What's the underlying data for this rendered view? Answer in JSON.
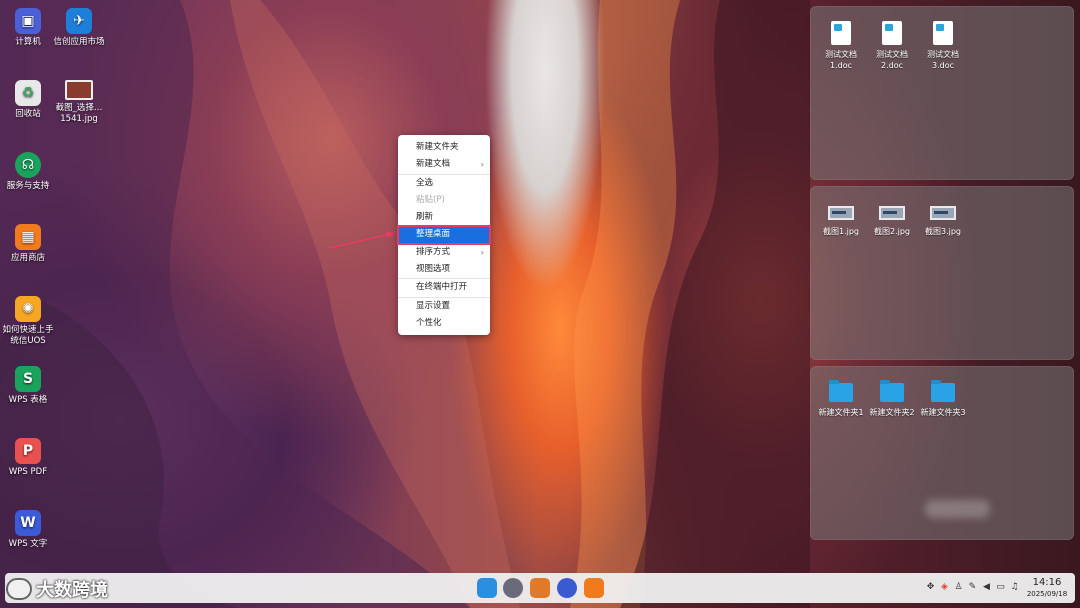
{
  "desktop": {
    "icons": [
      {
        "label": "计算机",
        "icon": "computer-icon",
        "color": "#4b5fd6"
      },
      {
        "label": "信创应用市场",
        "icon": "app-market-icon",
        "color": "#1e7fd8"
      },
      {
        "label": "回收站",
        "icon": "trash-icon",
        "color": "#e8e8e8"
      },
      {
        "label": "截图_选择…1541.jpg",
        "icon": "image-file-icon",
        "color": "#8a3b2f"
      },
      {
        "label": "服务与支持",
        "icon": "support-icon",
        "color": "#1aa35c"
      },
      {
        "label": "应用商店",
        "icon": "store-icon",
        "color": "#f07a1c"
      },
      {
        "label": "如何快速上手统信UOS",
        "icon": "bulb-icon",
        "color": "#f5a623"
      },
      {
        "label": "WPS 表格",
        "icon": "wps-sheet-icon",
        "color": "#1aa35c",
        "glyph": "S"
      },
      {
        "label": "WPS PDF",
        "icon": "wps-pdf-icon",
        "color": "#e8514f",
        "glyph": "P"
      },
      {
        "label": "WPS 文字",
        "icon": "wps-writer-icon",
        "color": "#3b5bd9",
        "glyph": "W"
      }
    ]
  },
  "panels": {
    "documents": [
      {
        "label": "测试文档1.doc"
      },
      {
        "label": "测试文档2.doc"
      },
      {
        "label": "测试文档3.doc"
      }
    ],
    "images": [
      {
        "label": "截图1.jpg"
      },
      {
        "label": "截图2.jpg"
      },
      {
        "label": "截图3.jpg"
      }
    ],
    "folders": [
      {
        "label": "新建文件夹1"
      },
      {
        "label": "新建文件夹2"
      },
      {
        "label": "新建文件夹3"
      }
    ]
  },
  "context_menu": {
    "items": [
      {
        "label": "新建文件夹",
        "submenu": false,
        "disabled": false
      },
      {
        "label": "新建文档",
        "submenu": true,
        "disabled": false
      },
      {
        "label": "全选",
        "submenu": false,
        "disabled": false
      },
      {
        "label": "粘贴(P)",
        "submenu": false,
        "disabled": true
      },
      {
        "label": "刷新",
        "submenu": false,
        "disabled": false
      },
      {
        "label": "整理桌面",
        "submenu": false,
        "disabled": false,
        "highlighted": true
      },
      {
        "label": "排序方式",
        "submenu": true,
        "disabled": false
      },
      {
        "label": "视图选项",
        "submenu": false,
        "disabled": false
      },
      {
        "label": "在终端中打开",
        "submenu": false,
        "disabled": false
      },
      {
        "label": "显示设置",
        "submenu": false,
        "disabled": false
      },
      {
        "label": "个性化",
        "submenu": false,
        "disabled": false
      }
    ],
    "highlight_color": "#1a6fe0",
    "annotation_color": "#e53b64"
  },
  "taskbar": {
    "watermark": "大数跨境",
    "apps": [
      {
        "icon": "file-manager-icon",
        "color": "#2a8fe0"
      },
      {
        "icon": "camera-icon",
        "color": "#6a6a7a"
      },
      {
        "icon": "image-viewer-icon",
        "color": "#e07a2a"
      },
      {
        "icon": "settings-icon",
        "color": "#3a5bd0"
      },
      {
        "icon": "app-store-icon",
        "color": "#f07a1c"
      }
    ],
    "tray": [
      "network-icon",
      "shield-icon",
      "penguin-icon",
      "pen-icon",
      "volume-icon",
      "battery-icon",
      "notification-icon"
    ],
    "time": "14:16",
    "date": "2025/09/18"
  }
}
